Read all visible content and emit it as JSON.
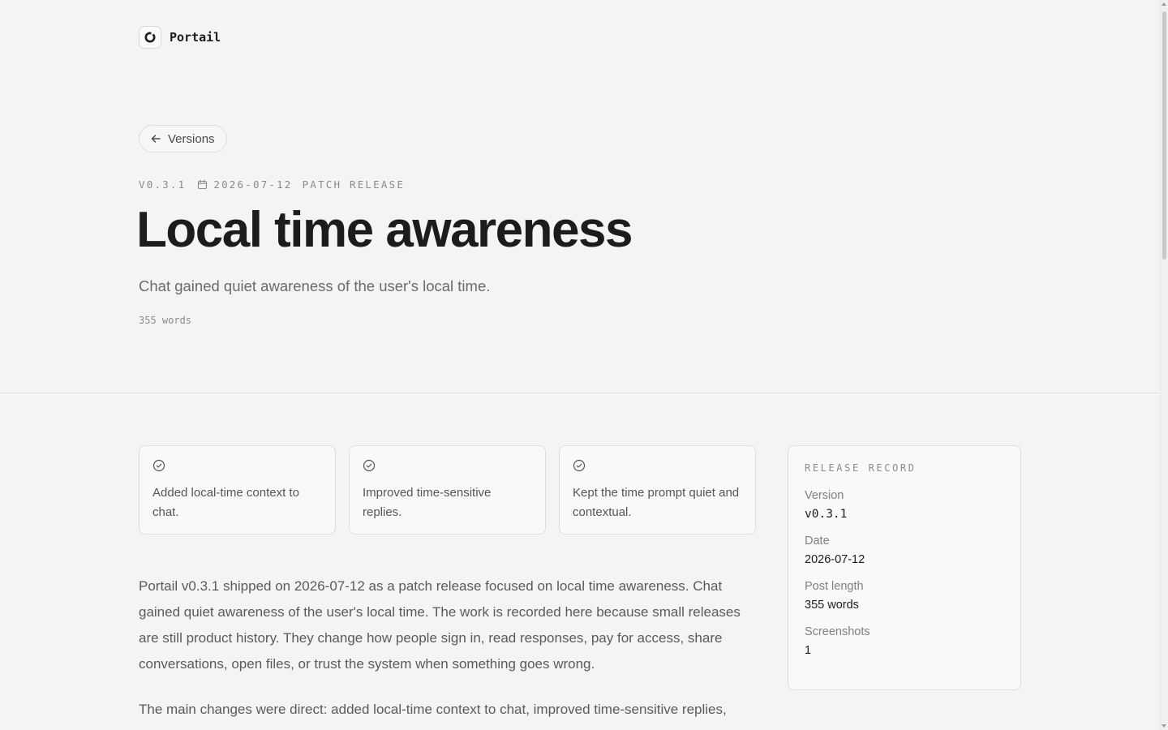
{
  "brand": {
    "name": "Portail",
    "icon": "portail-logo-icon"
  },
  "nav": {
    "back_label": "Versions",
    "back_icon": "arrow-left-icon"
  },
  "release": {
    "version": "V0.3.1",
    "date": "2026-07-12",
    "date_icon": "calendar-icon",
    "type": "PATCH RELEASE",
    "title": "Local time awareness",
    "subtitle": "Chat gained quiet awareness of the user's local time.",
    "word_count": "355 words"
  },
  "highlights": [
    {
      "icon": "check-circle-icon",
      "text": "Added local-time context to chat."
    },
    {
      "icon": "check-circle-icon",
      "text": "Improved time-sensitive replies."
    },
    {
      "icon": "check-circle-icon",
      "text": "Kept the time prompt quiet and contextual."
    }
  ],
  "body": [
    "Portail v0.3.1 shipped on 2026-07-12 as a patch release focused on local time awareness. Chat gained quiet awareness of the user's local time. The work is recorded here because small releases are still product history. They change how people sign in, read responses, pay for access, share conversations, open files, or trust the system when something goes wrong.",
    "The main changes were direct: added local-time context to chat, improved time-sensitive replies,"
  ],
  "record": {
    "title": "RELEASE RECORD",
    "fields": [
      {
        "label": "Version",
        "value": "v0.3.1"
      },
      {
        "label": "Date",
        "value": "2026-07-12"
      },
      {
        "label": "Post length",
        "value": "355 words"
      },
      {
        "label": "Screenshots",
        "value": "1"
      }
    ]
  }
}
